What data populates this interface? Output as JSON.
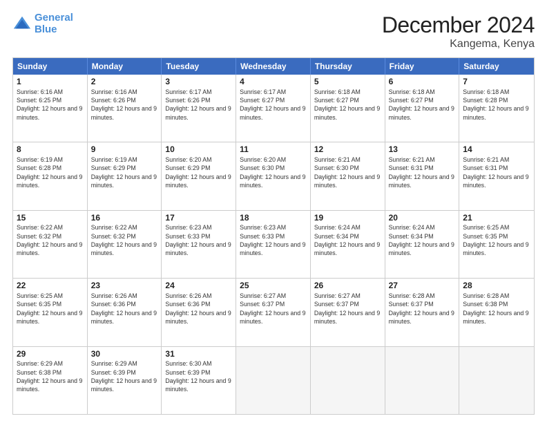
{
  "logo": {
    "line1": "General",
    "line2": "Blue"
  },
  "title": "December 2024",
  "location": "Kangema, Kenya",
  "days": [
    "Sunday",
    "Monday",
    "Tuesday",
    "Wednesday",
    "Thursday",
    "Friday",
    "Saturday"
  ],
  "weeks": [
    [
      {
        "day": "1",
        "sunrise": "6:16 AM",
        "sunset": "6:25 PM",
        "daylight": "12 hours and 9 minutes."
      },
      {
        "day": "2",
        "sunrise": "6:16 AM",
        "sunset": "6:26 PM",
        "daylight": "12 hours and 9 minutes."
      },
      {
        "day": "3",
        "sunrise": "6:17 AM",
        "sunset": "6:26 PM",
        "daylight": "12 hours and 9 minutes."
      },
      {
        "day": "4",
        "sunrise": "6:17 AM",
        "sunset": "6:27 PM",
        "daylight": "12 hours and 9 minutes."
      },
      {
        "day": "5",
        "sunrise": "6:18 AM",
        "sunset": "6:27 PM",
        "daylight": "12 hours and 9 minutes."
      },
      {
        "day": "6",
        "sunrise": "6:18 AM",
        "sunset": "6:27 PM",
        "daylight": "12 hours and 9 minutes."
      },
      {
        "day": "7",
        "sunrise": "6:18 AM",
        "sunset": "6:28 PM",
        "daylight": "12 hours and 9 minutes."
      }
    ],
    [
      {
        "day": "8",
        "sunrise": "6:19 AM",
        "sunset": "6:28 PM",
        "daylight": "12 hours and 9 minutes."
      },
      {
        "day": "9",
        "sunrise": "6:19 AM",
        "sunset": "6:29 PM",
        "daylight": "12 hours and 9 minutes."
      },
      {
        "day": "10",
        "sunrise": "6:20 AM",
        "sunset": "6:29 PM",
        "daylight": "12 hours and 9 minutes."
      },
      {
        "day": "11",
        "sunrise": "6:20 AM",
        "sunset": "6:30 PM",
        "daylight": "12 hours and 9 minutes."
      },
      {
        "day": "12",
        "sunrise": "6:21 AM",
        "sunset": "6:30 PM",
        "daylight": "12 hours and 9 minutes."
      },
      {
        "day": "13",
        "sunrise": "6:21 AM",
        "sunset": "6:31 PM",
        "daylight": "12 hours and 9 minutes."
      },
      {
        "day": "14",
        "sunrise": "6:21 AM",
        "sunset": "6:31 PM",
        "daylight": "12 hours and 9 minutes."
      }
    ],
    [
      {
        "day": "15",
        "sunrise": "6:22 AM",
        "sunset": "6:32 PM",
        "daylight": "12 hours and 9 minutes."
      },
      {
        "day": "16",
        "sunrise": "6:22 AM",
        "sunset": "6:32 PM",
        "daylight": "12 hours and 9 minutes."
      },
      {
        "day": "17",
        "sunrise": "6:23 AM",
        "sunset": "6:33 PM",
        "daylight": "12 hours and 9 minutes."
      },
      {
        "day": "18",
        "sunrise": "6:23 AM",
        "sunset": "6:33 PM",
        "daylight": "12 hours and 9 minutes."
      },
      {
        "day": "19",
        "sunrise": "6:24 AM",
        "sunset": "6:34 PM",
        "daylight": "12 hours and 9 minutes."
      },
      {
        "day": "20",
        "sunrise": "6:24 AM",
        "sunset": "6:34 PM",
        "daylight": "12 hours and 9 minutes."
      },
      {
        "day": "21",
        "sunrise": "6:25 AM",
        "sunset": "6:35 PM",
        "daylight": "12 hours and 9 minutes."
      }
    ],
    [
      {
        "day": "22",
        "sunrise": "6:25 AM",
        "sunset": "6:35 PM",
        "daylight": "12 hours and 9 minutes."
      },
      {
        "day": "23",
        "sunrise": "6:26 AM",
        "sunset": "6:36 PM",
        "daylight": "12 hours and 9 minutes."
      },
      {
        "day": "24",
        "sunrise": "6:26 AM",
        "sunset": "6:36 PM",
        "daylight": "12 hours and 9 minutes."
      },
      {
        "day": "25",
        "sunrise": "6:27 AM",
        "sunset": "6:37 PM",
        "daylight": "12 hours and 9 minutes."
      },
      {
        "day": "26",
        "sunrise": "6:27 AM",
        "sunset": "6:37 PM",
        "daylight": "12 hours and 9 minutes."
      },
      {
        "day": "27",
        "sunrise": "6:28 AM",
        "sunset": "6:37 PM",
        "daylight": "12 hours and 9 minutes."
      },
      {
        "day": "28",
        "sunrise": "6:28 AM",
        "sunset": "6:38 PM",
        "daylight": "12 hours and 9 minutes."
      }
    ],
    [
      {
        "day": "29",
        "sunrise": "6:29 AM",
        "sunset": "6:38 PM",
        "daylight": "12 hours and 9 minutes."
      },
      {
        "day": "30",
        "sunrise": "6:29 AM",
        "sunset": "6:39 PM",
        "daylight": "12 hours and 9 minutes."
      },
      {
        "day": "31",
        "sunrise": "6:30 AM",
        "sunset": "6:39 PM",
        "daylight": "12 hours and 9 minutes."
      },
      null,
      null,
      null,
      null
    ]
  ]
}
